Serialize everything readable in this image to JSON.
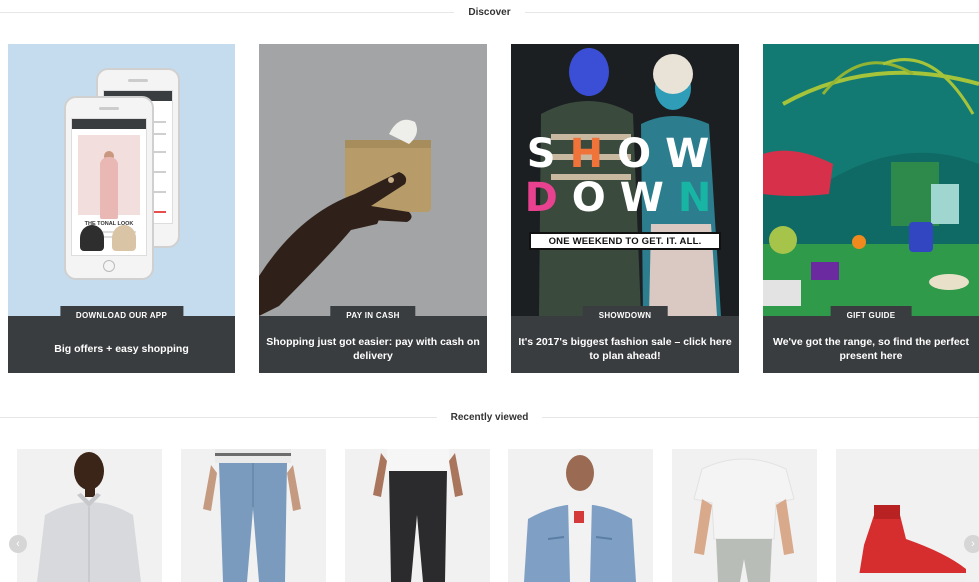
{
  "discover": {
    "title": "Discover",
    "cards": [
      {
        "tag": "DOWNLOAD OUR APP",
        "caption": "Big offers + easy shopping",
        "app_look_label": "THE TONAL LOOK"
      },
      {
        "tag": "PAY IN CASH",
        "caption": "Shopping just got easier: pay with cash on delivery"
      },
      {
        "tag": "SHOWDOWN",
        "caption": "It's 2017's biggest fashion sale – click here to plan ahead!",
        "headline_line1": "SHOW",
        "headline_line2": "DOWN",
        "banner": "ONE WEEKEND TO GET. IT. ALL."
      },
      {
        "tag": "GIFT GUIDE",
        "caption": "We've got the range, so find the perfect present here"
      }
    ]
  },
  "recently_viewed": {
    "title": "Recently viewed",
    "prev_icon": "chevron-left-icon",
    "next_icon": "chevron-right-icon"
  },
  "colors": {
    "caption_bg": "#3a3d3f",
    "app_bg": "#c4dced",
    "cash_bg": "#a2a4a6",
    "show_bg": "#1b1f22",
    "gift_bg": "#0f6a66",
    "show_accent_pink": "#e8418f",
    "show_accent_orange": "#f0733a",
    "show_accent_teal": "#18b5a4"
  }
}
